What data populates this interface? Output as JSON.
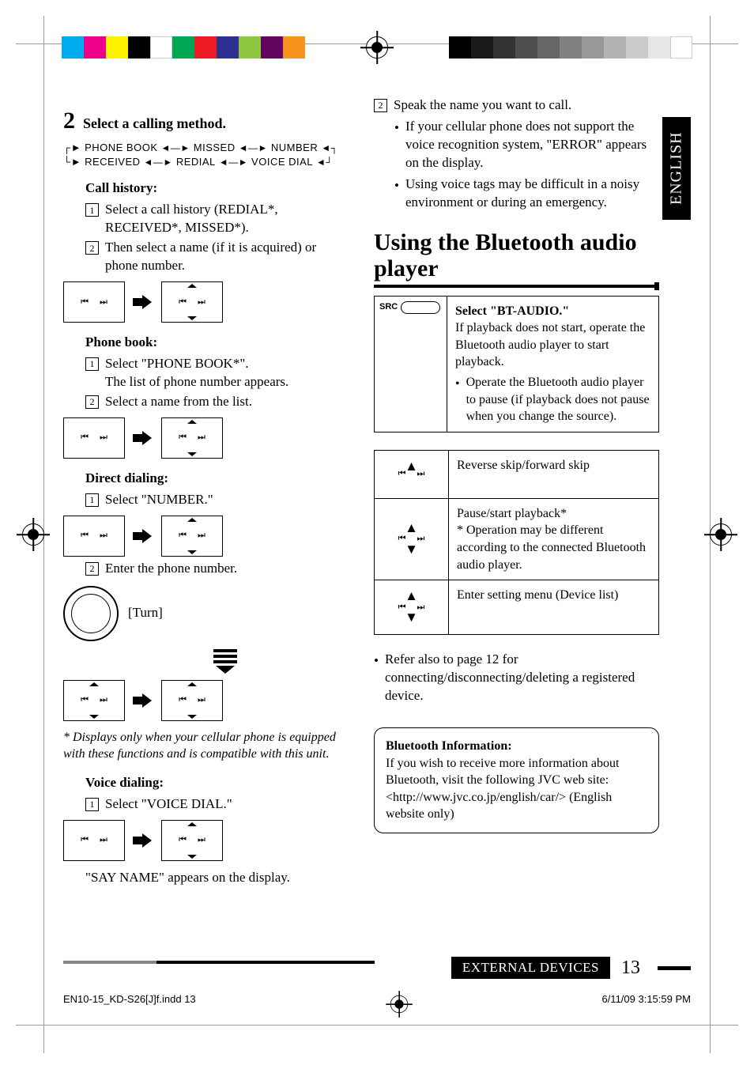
{
  "lang_tab": "ENGLISH",
  "left": {
    "step_num": "2",
    "step_title": "Select a calling method.",
    "flow": {
      "line1": [
        "PHONE BOOK",
        "MISSED",
        "NUMBER"
      ],
      "line2": [
        "RECEIVED",
        "REDIAL",
        "VOICE DIAL"
      ]
    },
    "call_history": {
      "title": "Call history:",
      "item1": "Select a call history (REDIAL*, RECEIVED*, MISSED*).",
      "item2": "Then select a name (if it is acquired) or phone number."
    },
    "phone_book": {
      "title": "Phone book:",
      "item1a": "Select \"PHONE BOOK*\".",
      "item1b": "The list of phone number appears.",
      "item2": "Select a name from the list."
    },
    "direct": {
      "title": "Direct dialing:",
      "item1": "Select \"NUMBER.\"",
      "item2": "Enter the phone number.",
      "turn": "[Turn]"
    },
    "footnote": "*  Displays only when your cellular phone is equipped with these functions and is compatible with this unit.",
    "voice": {
      "title": "Voice dialing:",
      "item1": "Select \"VOICE DIAL.\"",
      "note": "\"SAY NAME\" appears on the display."
    }
  },
  "right": {
    "item2": "Speak the name you want to call.",
    "b1": "If your cellular phone does not support the voice recognition system, \"ERROR\" appears on the display.",
    "b2": "Using voice tags may be difficult in a noisy environment or during an emergency.",
    "section": "Using the Bluetooth audio player",
    "src_label": "SRC",
    "bt_title": "Select \"BT-AUDIO.\"",
    "bt_p1": "If playback does not start, operate the Bluetooth audio player to start playback.",
    "bt_b1": "Operate the Bluetooth audio player to pause (if playback does not pause when you change the source).",
    "ctrl1": "Reverse skip/forward skip",
    "ctrl2a": "Pause/start playback*",
    "ctrl2b": "*  Operation may be different according to the connected Bluetooth audio player.",
    "ctrl3": "Enter setting menu (Device list)",
    "refer": "Refer also to page 12 for connecting/disconnecting/deleting a registered device.",
    "info_title": "Bluetooth Information:",
    "info_body": "If you wish to receive more information about Bluetooth, visit the following JVC web site: <http://www.jvc.co.jp/english/car/> (English website only)"
  },
  "footer": {
    "section": "EXTERNAL DEVICES",
    "page": "13",
    "file": "EN10-15_KD-S26[J]f.indd   13",
    "date": "6/11/09   3:15:59 PM"
  }
}
